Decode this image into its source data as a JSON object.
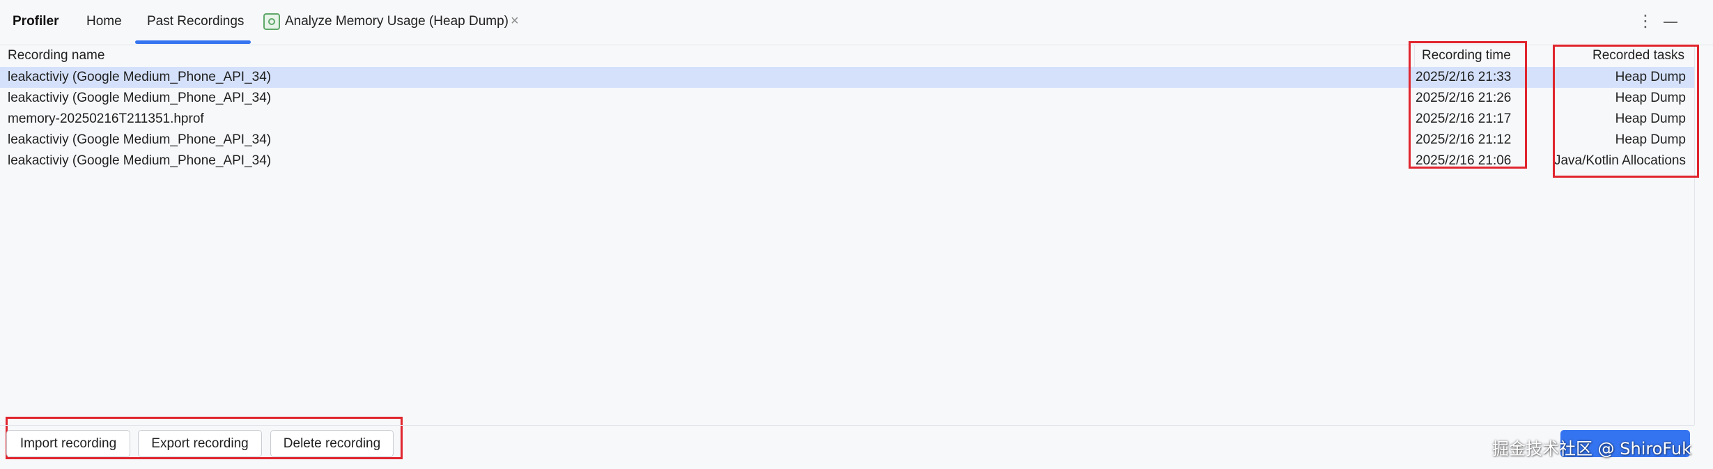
{
  "header": {
    "brand": "Profiler",
    "tabs": [
      {
        "label": "Home"
      },
      {
        "label": "Past Recordings"
      },
      {
        "label": "Analyze Memory Usage (Heap Dump)"
      }
    ],
    "close_glyph": "×",
    "more_glyph": "⋮",
    "active_tab": "Past Recordings",
    "accent_color": "#3574f0"
  },
  "table": {
    "columns": [
      "Recording name",
      "Recording time",
      "Recorded tasks"
    ],
    "rows": [
      {
        "name": "leakactiviy (Google Medium_Phone_API_34)",
        "time": "2025/2/16 21:33",
        "tasks": "Heap Dump",
        "selected": true
      },
      {
        "name": "leakactiviy (Google Medium_Phone_API_34)",
        "time": "2025/2/16 21:26",
        "tasks": "Heap Dump",
        "selected": false
      },
      {
        "name": "memory-20250216T211351.hprof",
        "time": "2025/2/16 21:17",
        "tasks": "Heap Dump",
        "selected": false
      },
      {
        "name": "leakactiviy (Google Medium_Phone_API_34)",
        "time": "2025/2/16 21:12",
        "tasks": "Heap Dump",
        "selected": false
      },
      {
        "name": "leakactiviy (Google Medium_Phone_API_34)",
        "time": "2025/2/16 21:06",
        "tasks": "Java/Kotlin Allocations",
        "selected": false
      }
    ],
    "selection_color": "#d5e1fb"
  },
  "footer": {
    "import_label": "Import recording",
    "export_label": "Export recording",
    "delete_label": "Delete recording",
    "watermark": "掘金技术社区 @ ShiroFuk"
  },
  "annotation_color": "#e0252e"
}
